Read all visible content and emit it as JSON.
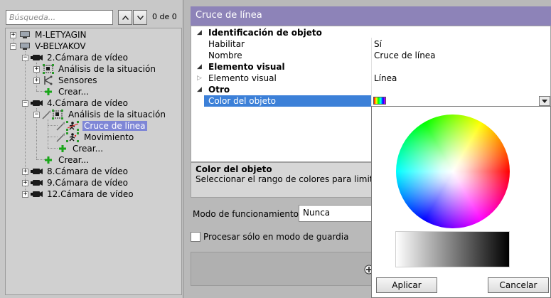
{
  "search": {
    "placeholder": "Búsqueda...",
    "count": "0 de 0"
  },
  "tree": {
    "nodes": [
      {
        "label": "M-LETYAGIN"
      },
      {
        "label": "V-BELYAKOV"
      },
      {
        "label": "2.Cámara de vídeo"
      },
      {
        "label": "Análisis de la situación"
      },
      {
        "label": "Sensores"
      },
      {
        "label": "Crear..."
      },
      {
        "label": "4.Cámara de vídeo"
      },
      {
        "label": "Análisis de la situación"
      },
      {
        "label": "Cruce de línea"
      },
      {
        "label": "Movimiento"
      },
      {
        "label": "Crear..."
      },
      {
        "label": "Crear..."
      },
      {
        "label": "8.Cámara de vídeo"
      },
      {
        "label": "9.Cámara de vídeo"
      },
      {
        "label": "12.Cámara de vídeo"
      }
    ]
  },
  "header": {
    "title": "Cruce de línea"
  },
  "properties": {
    "cat1": "Identificación de objeto",
    "habilitar_name": "Habilitar",
    "habilitar_val": "Sí",
    "nombre_name": "Nombre",
    "nombre_val": "Cruce de línea",
    "cat2": "Elemento visual",
    "elemento_name": "Elemento visual",
    "elemento_val": "Línea",
    "cat3": "Otro",
    "color_name": "Color del objeto"
  },
  "description": {
    "title": "Color del objeto",
    "text": "Seleccionar el rango de colores para limitar l"
  },
  "mode": {
    "label": "Modo de funcionamiento",
    "value": "Nunca"
  },
  "guard": {
    "label": "Procesar sólo en modo de guardia"
  },
  "popup": {
    "apply": "Aplicar",
    "cancel": "Cancelar"
  },
  "colors": {
    "header": "#8d83b8",
    "selection": "#7e86d6",
    "property_selection": "#3c80d8"
  }
}
